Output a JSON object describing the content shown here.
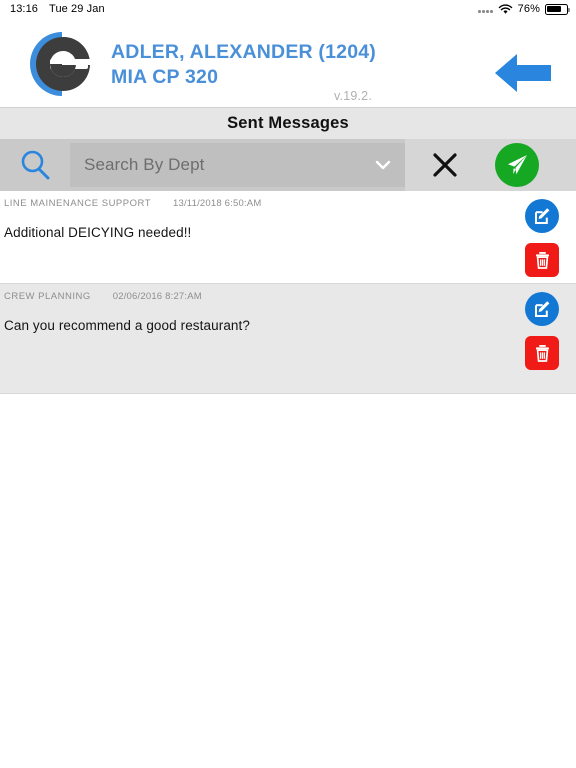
{
  "status_bar": {
    "time": "13:16",
    "date": "Tue 29 Jan",
    "battery_percent": "76%",
    "wifi_icon": "wifi-icon",
    "battery_icon": "battery-icon",
    "signal_icon": "signal-dots-icon"
  },
  "header": {
    "logo_icon": "e-logo-icon",
    "user_name": "ADLER, ALEXANDER (1204)",
    "user_base": "MIA CP 320",
    "version": "v.19.2.",
    "back_icon": "back-arrow-icon",
    "accent_color": "#4a90d9"
  },
  "page": {
    "title": "Sent Messages"
  },
  "toolbar": {
    "search_icon": "search-icon",
    "dept_placeholder": "Search By Dept",
    "dept_value": "",
    "chevron_icon": "chevron-down-icon",
    "clear_icon": "close-x-icon",
    "send_icon": "paper-plane-icon",
    "send_color": "#16a723"
  },
  "messages": [
    {
      "dept": "LINE MAINENANCE SUPPORT",
      "date": "13/11/2018 6:50:AM",
      "body": "Additional DEICYING needed!!",
      "edit_icon": "edit-pencil-icon",
      "delete_icon": "trash-icon"
    },
    {
      "dept": "CREW PLANNING",
      "date": "02/06/2016 8:27:AM",
      "body": "Can you recommend a good restaurant?",
      "edit_icon": "edit-pencil-icon",
      "delete_icon": "trash-icon"
    }
  ]
}
